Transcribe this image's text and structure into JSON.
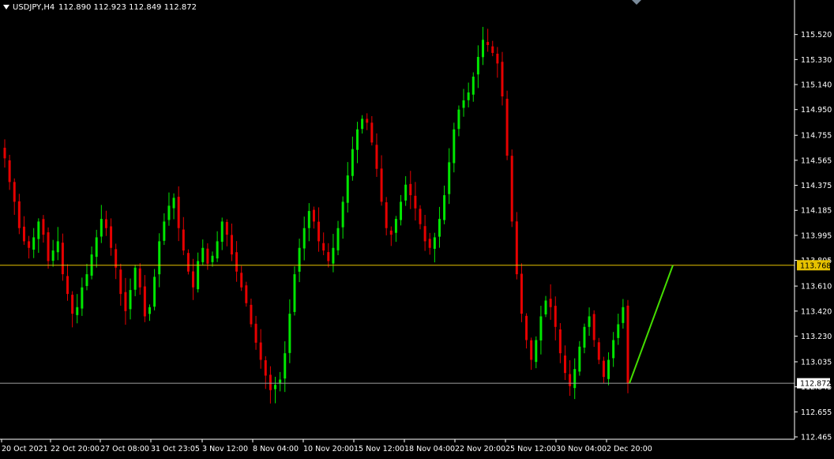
{
  "header": {
    "symbol": "USDJPY,H4",
    "ohlc": "112.890 112.923 112.849 112.872"
  },
  "colors": {
    "background": "#000000",
    "axis": "#ffffff",
    "bull": "#00e600",
    "bear": "#e60000",
    "level_line": "#e6c200",
    "bid_line": "#a0a0a0",
    "arrow": "#44dd00",
    "triangle": "#7a8a9a"
  },
  "chart_data": {
    "type": "candlestick",
    "ylim": [
      112.465,
      115.62
    ],
    "y_ticks": [
      "115.520",
      "115.330",
      "115.140",
      "114.950",
      "114.755",
      "114.565",
      "114.375",
      "114.185",
      "113.995",
      "113.805",
      "113.610",
      "113.420",
      "113.230",
      "113.035",
      "112.845",
      "112.655",
      "112.465"
    ],
    "x_ticks": [
      "20 Oct 2021",
      "22 Oct 20:00",
      "27 Oct 08:00",
      "31 Oct 23:05",
      "3 Nov 12:00",
      "8 Nov 04:00",
      "10 Nov 20:00",
      "15 Nov 12:00",
      "18 Nov 04:00",
      "22 Nov 20:00",
      "25 Nov 12:00",
      "30 Nov 04:00",
      "2 Dec 20:00"
    ],
    "horizontal_levels": [
      {
        "label": "113.768",
        "value": 113.768,
        "role": "level"
      },
      {
        "label": "112.872",
        "value": 112.872,
        "role": "bid"
      }
    ],
    "projection": {
      "from": 112.872,
      "to": 113.768
    },
    "closes": [
      114.58,
      114.4,
      114.25,
      114.05,
      113.95,
      113.9,
      113.98,
      114.1,
      114.0,
      113.8,
      113.88,
      113.95,
      113.7,
      113.55,
      113.4,
      113.45,
      113.6,
      113.7,
      113.85,
      113.98,
      114.12,
      114.05,
      113.9,
      113.75,
      113.55,
      113.42,
      113.58,
      113.75,
      113.6,
      113.38,
      113.45,
      113.68,
      113.95,
      114.1,
      114.22,
      114.28,
      114.05,
      113.88,
      113.72,
      113.6,
      113.8,
      113.9,
      113.78,
      113.84,
      113.95,
      114.1,
      114.0,
      113.85,
      113.72,
      113.6,
      113.48,
      113.32,
      113.18,
      113.05,
      112.93,
      112.82,
      112.86,
      112.9,
      113.1,
      113.4,
      113.7,
      113.9,
      114.05,
      114.18,
      114.1,
      113.95,
      113.88,
      113.8,
      113.9,
      114.05,
      114.25,
      114.45,
      114.65,
      114.8,
      114.88,
      114.85,
      114.7,
      114.5,
      114.25,
      114.05,
      114.0,
      114.12,
      114.25,
      114.38,
      114.3,
      114.2,
      114.08,
      113.95,
      113.9,
      113.98,
      114.12,
      114.3,
      114.55,
      114.8,
      114.95,
      115.02,
      115.08,
      115.2,
      115.35,
      115.48,
      115.44,
      115.38,
      115.3,
      115.05,
      114.6,
      114.1,
      113.7,
      113.4,
      113.2,
      113.05,
      113.2,
      113.38,
      113.5,
      113.45,
      113.3,
      113.1,
      112.95,
      112.85,
      112.98,
      113.15,
      113.3,
      113.38,
      113.2,
      113.05,
      112.92,
      113.05,
      113.2,
      113.32,
      113.45,
      112.872
    ]
  }
}
